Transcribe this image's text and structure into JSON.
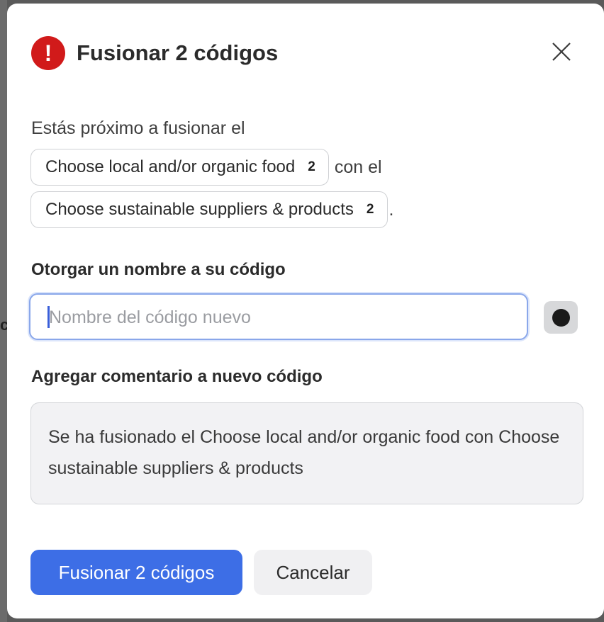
{
  "backdrop": {
    "edge_glyph": "c"
  },
  "dialog": {
    "title": "Fusionar 2 códigos",
    "alert_icon": "exclamation-icon",
    "close_icon": "close-icon"
  },
  "merge": {
    "intro": "Estás próximo a fusionar el",
    "source_code": {
      "label": "Choose local and/or organic food",
      "count": "2"
    },
    "connector": "con el",
    "target_code": {
      "label": "Choose sustainable suppliers & products",
      "count": "2"
    },
    "end_punctuation": "."
  },
  "name_section": {
    "label": "Otorgar un nombre a su código",
    "input_value": "",
    "input_placeholder": "Nombre del código nuevo",
    "color_swatch": "#1a1a1a"
  },
  "comment_section": {
    "label": "Agregar comentario a nuevo código",
    "value": "Se ha fusionado el Choose local and/or organic food con Choose sustainable suppliers & products"
  },
  "actions": {
    "confirm_label": "Fusionar 2 códigos",
    "cancel_label": "Cancelar"
  },
  "colors": {
    "alert": "#d11a1a",
    "primary": "#3d6ee6",
    "focus_border": "#8aa7ea"
  }
}
